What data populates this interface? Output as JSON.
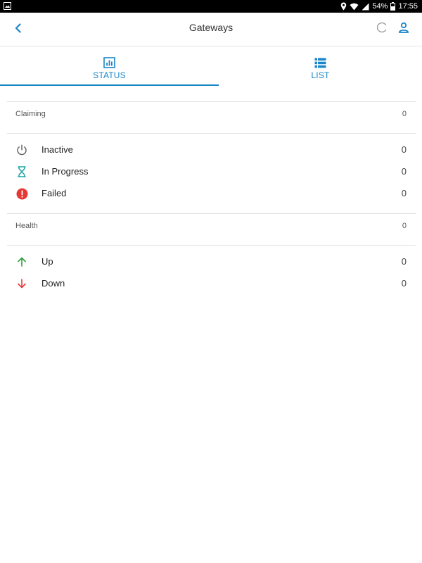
{
  "status_bar": {
    "battery": "54%",
    "time": "17:55"
  },
  "app_bar": {
    "title": "Gateways",
    "back_icon": "chevron-left-icon",
    "refresh_icon": "loading-spinner-icon",
    "user_icon": "user-icon"
  },
  "tabs": [
    {
      "label": "STATUS",
      "icon": "bar-chart-icon",
      "selected": true
    },
    {
      "label": "LIST",
      "icon": "list-icon",
      "selected": false
    }
  ],
  "claiming": {
    "label": "Claiming",
    "count": "0",
    "items": [
      {
        "label": "Inactive",
        "count": "0",
        "icon": "power-icon"
      },
      {
        "label": "In Progress",
        "count": "0",
        "icon": "hourglass-icon"
      },
      {
        "label": "Failed",
        "count": "0",
        "icon": "alert-circle-icon"
      }
    ]
  },
  "health": {
    "label": "Health",
    "count": "0",
    "items": [
      {
        "label": "Up",
        "count": "0",
        "icon": "arrow-up-icon"
      },
      {
        "label": "Down",
        "count": "0",
        "icon": "arrow-down-icon"
      }
    ]
  },
  "colors": {
    "accent": "#1a86c8",
    "hourglass": "#1aa3a3",
    "failed": "#e53935",
    "up": "#2e9e3a",
    "down": "#e53935"
  }
}
